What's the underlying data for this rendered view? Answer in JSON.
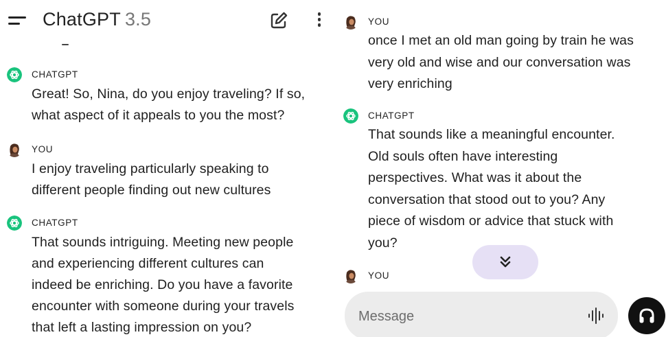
{
  "left": {
    "header": {
      "title": "ChatGPT",
      "version": "3.5"
    },
    "messages": [
      {
        "speaker": "CHATGPT",
        "lines": [
          "Great! So, Nina, do you enjoy traveling? If so,",
          "what aspect of it appeals to you the most?"
        ]
      },
      {
        "speaker": "YOU",
        "lines": [
          "I enjoy traveling particularly speaking to",
          "different people finding out new cultures"
        ]
      },
      {
        "speaker": "CHATGPT",
        "lines": [
          "That sounds intriguing. Meeting new people",
          "and experiencing different cultures can",
          "indeed be enriching. Do you have a favorite",
          "encounter with someone during your travels",
          "that left a lasting impression on you?"
        ]
      }
    ]
  },
  "right": {
    "messages": [
      {
        "speaker": "YOU",
        "lines": [
          "once I met an old man going by train he was",
          "very old and wise  and our conversation was",
          "very enriching"
        ]
      },
      {
        "speaker": "CHATGPT",
        "lines": [
          "That sounds like a meaningful encounter.",
          "Old souls often have interesting",
          "perspectives. What was it about the",
          "conversation that stood out to you? Any",
          "piece of wisdom or advice that stuck with",
          "you?"
        ]
      },
      {
        "speaker": "YOU",
        "lines": []
      }
    ],
    "composer": {
      "placeholder": "Message"
    }
  },
  "icons": {
    "menu": "menu-icon",
    "new_chat": "edit-icon",
    "more": "more-vert-icon",
    "chatgpt_avatar": "openai-logo-icon",
    "user_avatar": "user-photo-avatar",
    "scroll_down": "double-chevron-down-icon",
    "voice_input": "waveform-icon",
    "voice_mode": "headphones-icon"
  },
  "colors": {
    "chatgpt_avatar_bg": "#19c37d",
    "scroll_button_bg": "#e6e0f5",
    "composer_bg": "#ececec",
    "voice_button_bg": "#111111"
  }
}
